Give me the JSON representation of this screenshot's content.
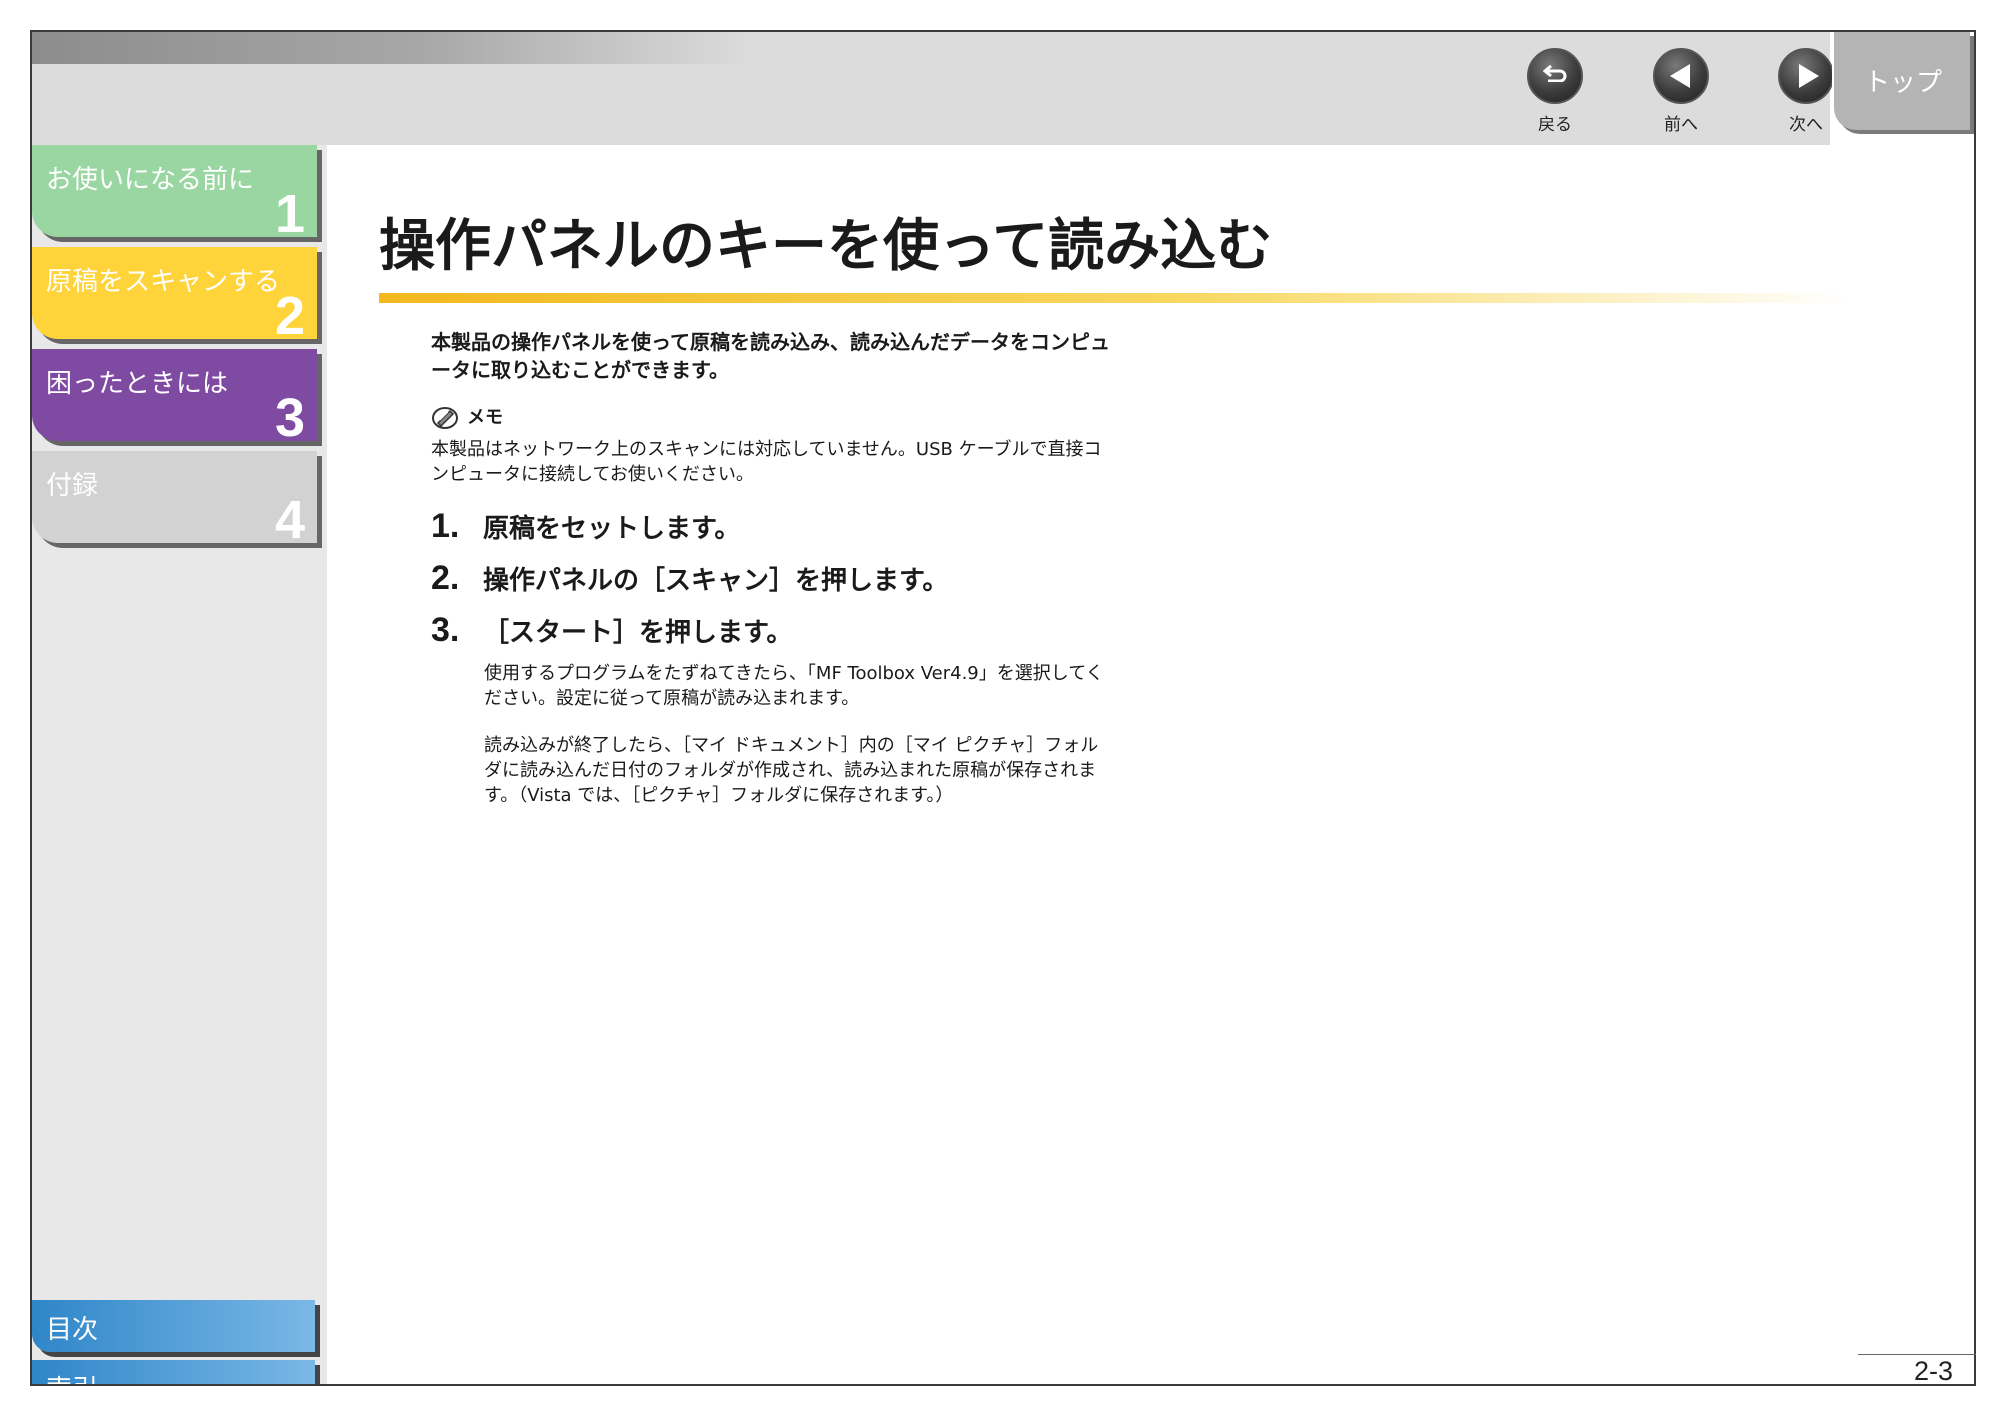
{
  "nav": {
    "back_label": "戻る",
    "prev_label": "前へ",
    "next_label": "次へ",
    "top_label": "トップ"
  },
  "sidebar": {
    "chapters": [
      {
        "title": "お使いになる前に",
        "number": "1",
        "color": "#9ad6a2"
      },
      {
        "title": "原稿をスキャンする",
        "number": "2",
        "color": "#ffd43a"
      },
      {
        "title": "困ったときには",
        "number": "3",
        "color": "#7f4aa2"
      },
      {
        "title": "付録",
        "number": "4",
        "color": "#d2d2d2"
      }
    ],
    "toc_label": "目次",
    "index_label": "索引"
  },
  "main": {
    "title": "操作パネルのキーを使って読み込む",
    "intro": "本製品の操作パネルを使って原稿を読み込み、読み込んだデータをコンピュータに取り込むことができます。",
    "memo_label": "メモ",
    "memo_text": "本製品はネットワーク上のスキャンには対応していません。USB ケーブルで直接コンピュータに接続してお使いください。",
    "steps": [
      {
        "number": "1.",
        "text": "原稿をセットします。"
      },
      {
        "number": "2.",
        "text": "操作パネルの［スキャン］を押します。"
      },
      {
        "number": "3.",
        "text": "［スタート］を押します。"
      }
    ],
    "step3_paragraphs": [
      "使用するプログラムをたずねてきたら、「MF Toolbox Ver4.9」を選択してください。設定に従って原稿が読み込まれます。",
      "読み込みが終了したら、［マイ ドキュメント］内の［マイ ピクチャ］フォルダに読み込んだ日付のフォルダが作成され、読み込まれた原稿が保存されます。（Vista では、［ピクチャ］フォルダに保存されます。）"
    ]
  },
  "page_number": "2-3"
}
